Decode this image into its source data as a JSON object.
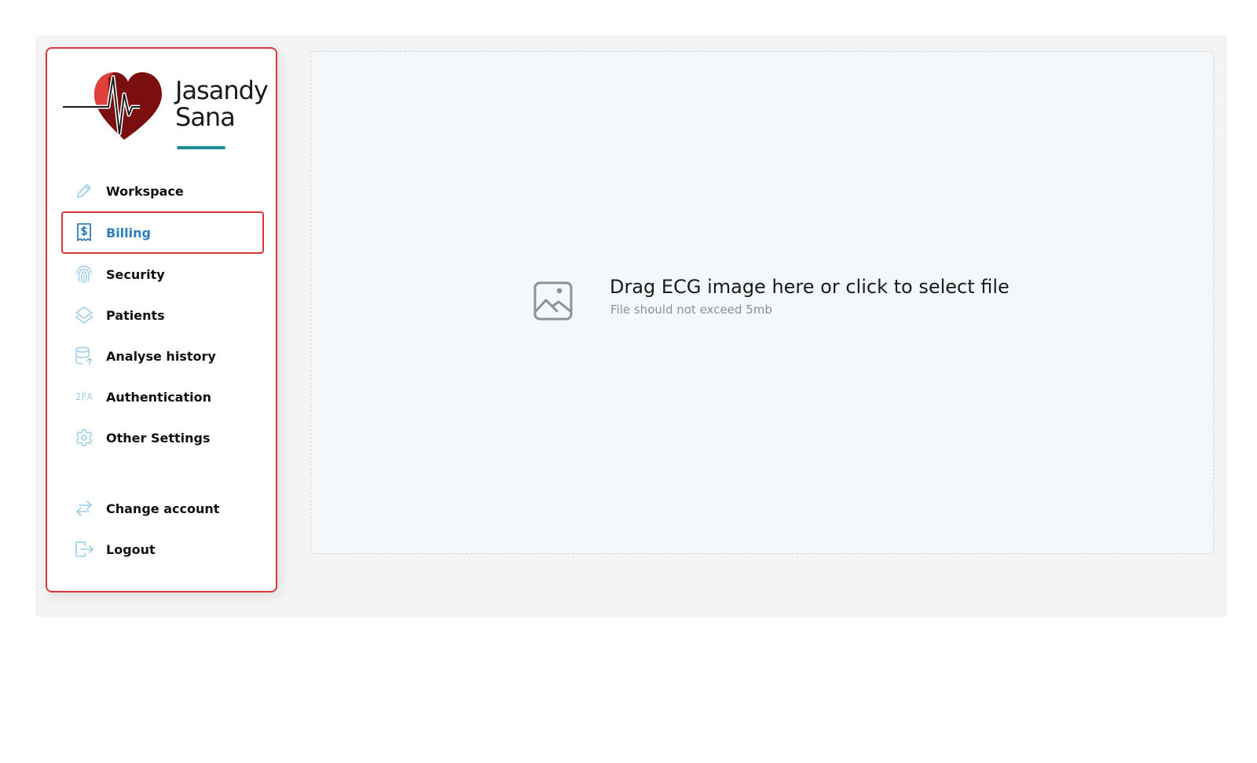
{
  "brand": {
    "line1": "Jasandy",
    "line2": "Sana",
    "colors": {
      "heart_dark": "#7b0f10",
      "heart_light": "#e0403c",
      "underline": "#1d8e93"
    }
  },
  "sidebar": {
    "accent_color": "#d9383b",
    "items": [
      {
        "label": "Workspace",
        "icon": "pencil-icon"
      },
      {
        "label": "Billing",
        "icon": "receipt-dollar-icon",
        "active": true
      },
      {
        "label": "Security",
        "icon": "fingerprint-icon"
      },
      {
        "label": "Patients",
        "icon": "layers-icon"
      },
      {
        "label": "Analyse history",
        "icon": "database-upload-icon"
      },
      {
        "label": "Authentication",
        "icon": "2fa-icon",
        "icon_text": "2FA"
      },
      {
        "label": "Other Settings",
        "icon": "gear-icon"
      },
      {
        "label": "Change account",
        "icon": "swap-arrows-icon"
      },
      {
        "label": "Logout",
        "icon": "logout-icon"
      }
    ]
  },
  "dropzone": {
    "icon": "image-icon",
    "title": "Drag ECG image here or click to select file",
    "subtitle": "File should not exceed 5mb"
  }
}
